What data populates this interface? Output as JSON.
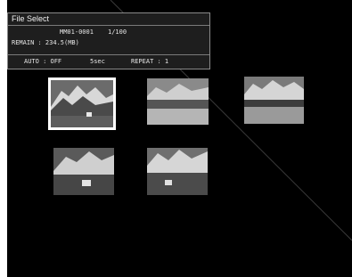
{
  "panel": {
    "title": "File Select",
    "file_name": "MM01-0001",
    "file_index": "1/100",
    "remain_label": "REMAIN : 234.5(MB)",
    "auto": "AUTO : OFF",
    "interval": "5sec",
    "repeat": "REPEAT : 1"
  },
  "thumbnails": [
    {
      "name": "mountain-village-1",
      "selected": true
    },
    {
      "name": "mountain-lake-1",
      "selected": false
    },
    {
      "name": "mountain-lake-2",
      "selected": false
    },
    {
      "name": "mountain-village-2",
      "selected": false
    },
    {
      "name": "mountain-village-3",
      "selected": false
    }
  ],
  "colors": {
    "background": "#000000",
    "panel": "#1e1e1e",
    "selection": "#ffffff"
  }
}
